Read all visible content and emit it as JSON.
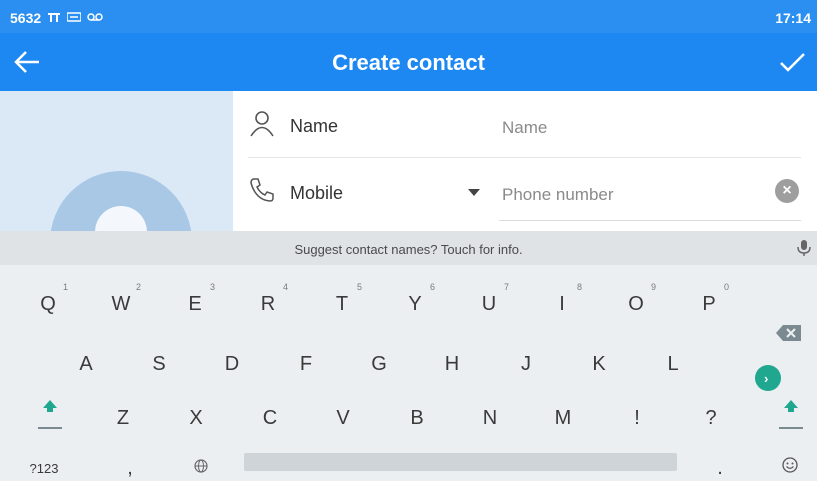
{
  "status_bar": {
    "left_text": "5632",
    "time": "17:14"
  },
  "app_bar": {
    "title": "Create contact",
    "back_icon": "arrow-left-icon",
    "save_icon": "check-icon"
  },
  "form": {
    "name_label": "Name",
    "name_placeholder": "Name",
    "mobile_label": "Mobile",
    "phone_placeholder": "Phone number"
  },
  "keyboard": {
    "suggestion": "Suggest contact names? Touch for info.",
    "row1": [
      {
        "key": "Q",
        "num": "1"
      },
      {
        "key": "W",
        "num": "2"
      },
      {
        "key": "E",
        "num": "3"
      },
      {
        "key": "R",
        "num": "4"
      },
      {
        "key": "T",
        "num": "5"
      },
      {
        "key": "Y",
        "num": "6"
      },
      {
        "key": "U",
        "num": "7"
      },
      {
        "key": "I",
        "num": "8"
      },
      {
        "key": "O",
        "num": "9"
      },
      {
        "key": "P",
        "num": "0"
      }
    ],
    "row2": [
      "A",
      "S",
      "D",
      "F",
      "G",
      "H",
      "J",
      "K",
      "L"
    ],
    "row3": [
      "Z",
      "X",
      "C",
      "V",
      "B",
      "N",
      "M",
      "!",
      "?"
    ],
    "symbols_label": "?123",
    "comma": ",",
    "period": "."
  },
  "colors": {
    "status_bar": "#2a8ff0",
    "app_bar": "#1e88f2",
    "accent": "#1fa88f",
    "keyboard_bg": "#eceff1"
  }
}
